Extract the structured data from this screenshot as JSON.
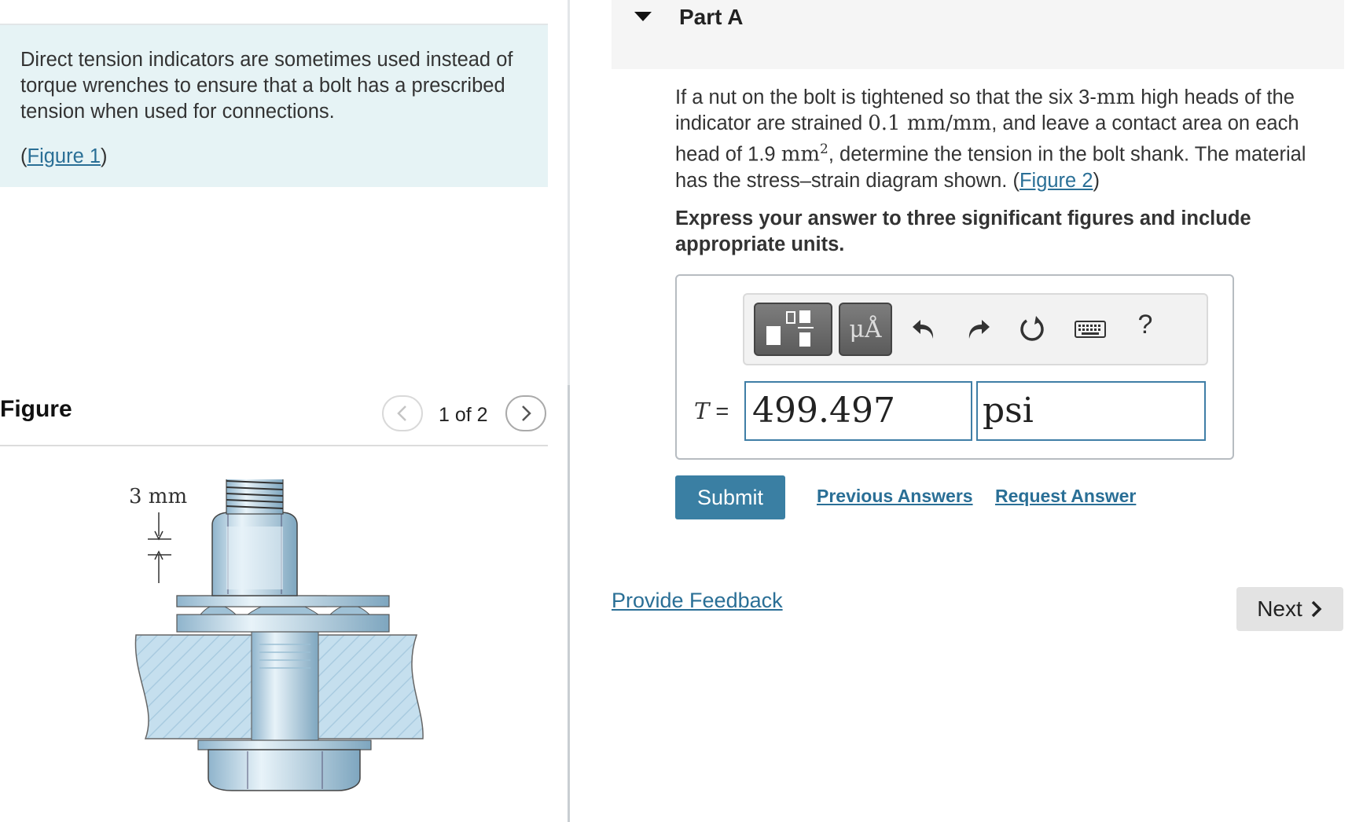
{
  "intro": {
    "text": "Direct tension indicators are sometimes used instead of torque wrenches to ensure that a bolt has a prescribed tension when used for connections.",
    "figure_link_open": "(",
    "figure_link": "Figure 1",
    "figure_link_close": ")"
  },
  "figure_panel": {
    "title": "Figure",
    "pager_text": "1 of 2",
    "dimension_label": "3 mm"
  },
  "part": {
    "title": "Part A"
  },
  "question": {
    "t1": "If a nut on the bolt is tightened so that the six 3-",
    "m1": "mm",
    "t2": " high heads of the indicator are strained ",
    "m2": "0.1 mm/mm",
    "t3": ", and leave a contact area on each head of 1.9 ",
    "m3": "mm",
    "m3_sup": "2",
    "t4": ", determine the tension in the bolt shank. The material has the stress–strain diagram shown. (",
    "figure_link": "Figure 2",
    "t5": ")"
  },
  "instruction": "Express your answer to three significant figures and include appropriate units.",
  "answer": {
    "variable": "T",
    "equals": " =",
    "value": "499.497",
    "units": "psi"
  },
  "toolbar": {
    "templates_icon": "templates-icon",
    "units_label": "μÅ",
    "undo_icon": "undo-icon",
    "redo_icon": "redo-icon",
    "reset_icon": "reset-icon",
    "keyboard_icon": "keyboard-icon",
    "help_label": "?"
  },
  "actions": {
    "submit": "Submit",
    "previous_answers": "Previous Answers",
    "request_answer": "Request Answer"
  },
  "footer": {
    "feedback": "Provide Feedback",
    "next": "Next"
  }
}
